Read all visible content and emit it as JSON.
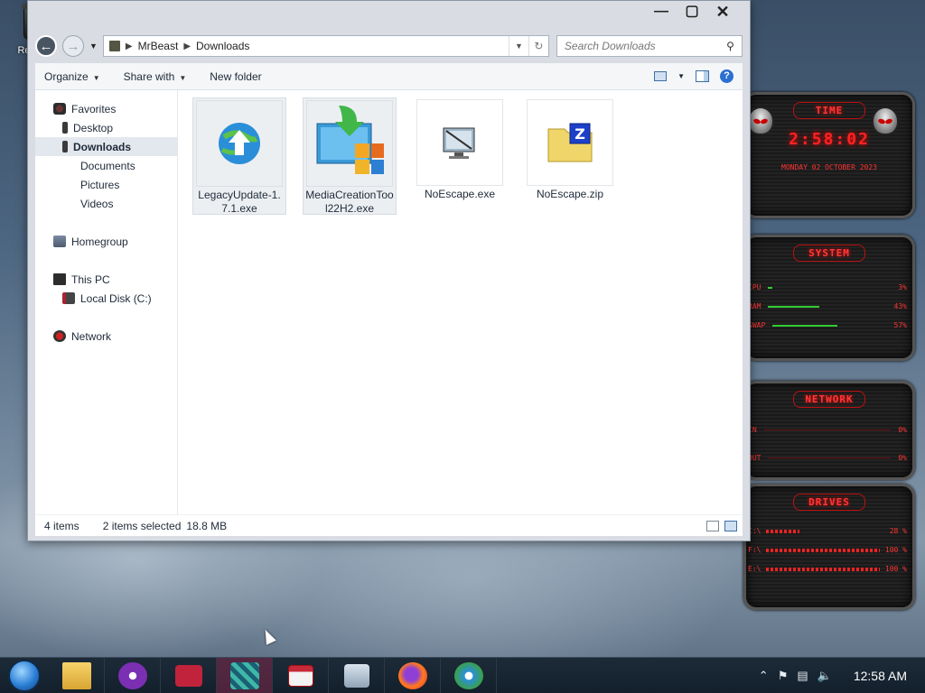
{
  "desktop": {
    "recycle_bin_label": "Recycle Bin"
  },
  "window": {
    "address": {
      "crumbs": [
        "MrBeast",
        "Downloads"
      ]
    },
    "search_placeholder": "Search Downloads",
    "toolbar": {
      "organize": "Organize",
      "share_with": "Share with",
      "new_folder": "New folder"
    },
    "nav": {
      "favorites": "Favorites",
      "desktop": "Desktop",
      "downloads": "Downloads",
      "documents": "Documents",
      "pictures": "Pictures",
      "videos": "Videos",
      "homegroup": "Homegroup",
      "this_pc": "This PC",
      "local_disk": "Local Disk (C:)",
      "network": "Network"
    },
    "files": [
      {
        "name": "LegacyUpdate-1.7.1.exe",
        "icon": "legacy-update-icon",
        "selected": true
      },
      {
        "name": "MediaCreationTool22H2.exe",
        "icon": "media-creation-tool-icon",
        "selected": true
      },
      {
        "name": "NoEscape.exe",
        "icon": "computer-program-icon",
        "selected": false
      },
      {
        "name": "NoEscape.zip",
        "icon": "zip-folder-icon",
        "selected": false
      }
    ],
    "status": {
      "item_count": "4 items",
      "selected": "2 items selected",
      "size": "18.8 MB"
    }
  },
  "gadget": {
    "time_title": "TIME",
    "time": "2:58:02",
    "date": "MONDAY 02 OCTOBER 2023",
    "system_title": "SYSTEM",
    "cpu_label": "CPU",
    "cpu_value": "3%",
    "cpu_fraction": 0.03,
    "ram_label": "RAM",
    "ram_value": "43%",
    "ram_fraction": 0.43,
    "swap_label": "SWAP",
    "swap_value": "57%",
    "swap_fraction": 0.57,
    "network_title": "NETWORK",
    "in_label": "IN",
    "in_value": "0%",
    "out_label": "OUT",
    "out_value": "0%",
    "drives_title": "DRIVES",
    "drives": [
      {
        "label": "C:\\",
        "value": "28 %",
        "fraction": 0.28
      },
      {
        "label": "F:\\",
        "value": "100 %",
        "fraction": 1.0
      },
      {
        "label": "E:\\",
        "value": "100 %",
        "fraction": 1.0
      }
    ],
    "accent": "#ff2222"
  },
  "taskbar": {
    "apps": [
      "explorer",
      "masked-app",
      "screen-recorder",
      "puzzle-app",
      "window-app",
      "system-monitor",
      "firefox",
      "legacy-update"
    ],
    "clock": "12:58 AM"
  }
}
